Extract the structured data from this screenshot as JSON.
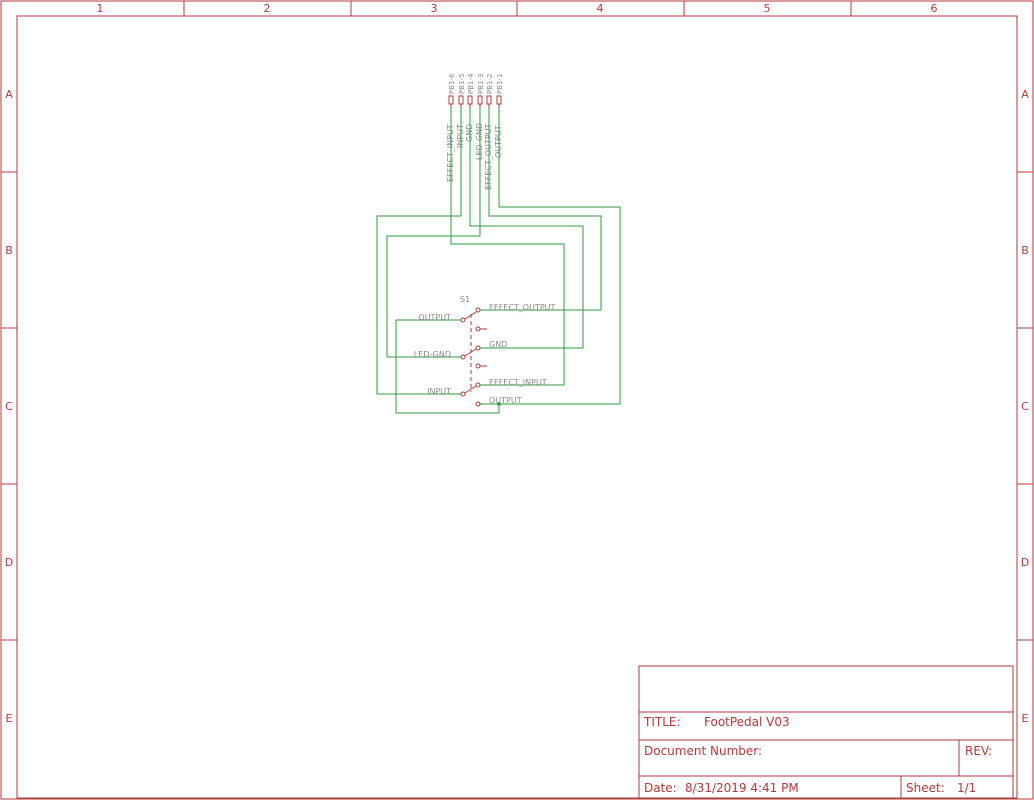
{
  "sheet": {
    "column_labels": [
      "1",
      "2",
      "3",
      "4",
      "5",
      "6"
    ],
    "row_labels": [
      "A",
      "B",
      "C",
      "D",
      "E"
    ]
  },
  "title_block": {
    "title_label": "TITLE:",
    "title_value": "FootPedal V03",
    "docnum_label": "Document Number:",
    "rev_label": "REV:",
    "date_label": "Date:",
    "date_value": "8/31/2019 4:41 PM",
    "sheet_label": "Sheet:",
    "sheet_value": "1/1"
  },
  "connector": {
    "pins": [
      "PB1-6",
      "PB1-5",
      "PB1-4",
      "PB1-3",
      "PB1-2",
      "PB1-1"
    ],
    "nets": [
      "EFFECT_INPUT",
      "INPUT",
      "GND",
      "LED-GND",
      "EFFECT_OUTPUT",
      "OUTPUT"
    ]
  },
  "switch": {
    "ref": "S1",
    "left_labels": [
      "OUTPUT",
      "LED-GND",
      "INPUT"
    ],
    "right_labels": [
      "EFFECT_OUTPUT",
      "GND",
      "EFFECT_INPUT",
      "OUTPUT"
    ]
  },
  "colors": {
    "frame": "#b03a3a",
    "wire": "#2e9a3c",
    "label": "#8a8a8a"
  }
}
